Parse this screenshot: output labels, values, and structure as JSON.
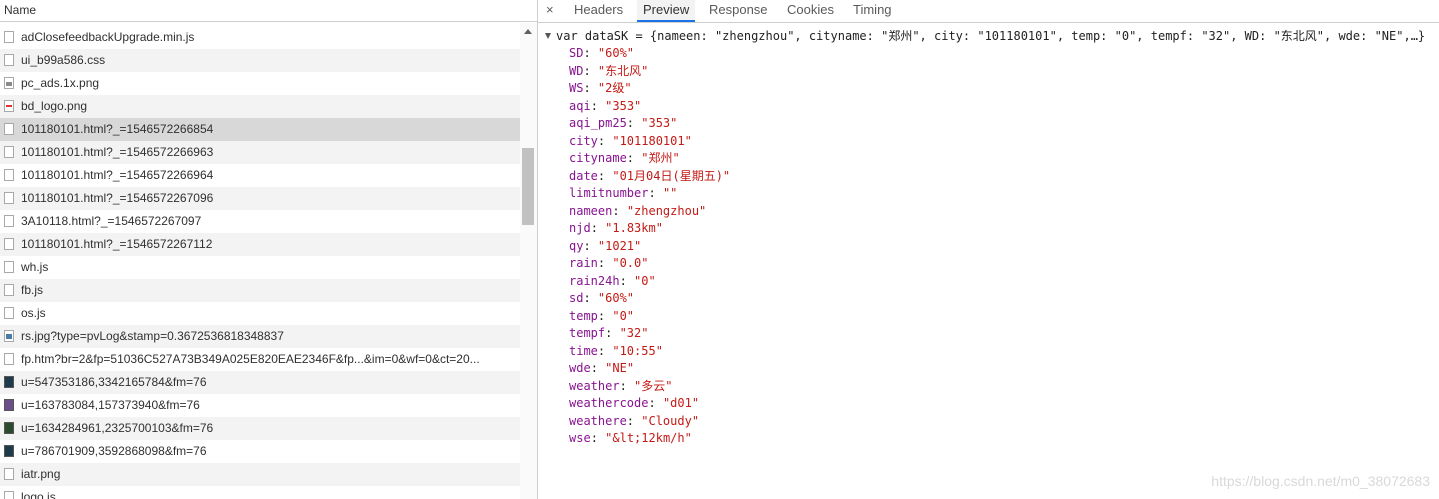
{
  "left_panel": {
    "column_header": "Name",
    "rows": [
      {
        "name": "adClosefeedbackUpgrade.min.js",
        "icon": "file-icon"
      },
      {
        "name": "ui_b99a586.css",
        "icon": "file-icon"
      },
      {
        "name": "pc_ads.1x.png",
        "icon": "image-file-icon"
      },
      {
        "name": "bd_logo.png",
        "icon": "image-file-icon"
      },
      {
        "name": "101180101.html?_=1546572266854",
        "icon": "file-icon",
        "selected": true
      },
      {
        "name": "101180101.html?_=1546572266963",
        "icon": "file-icon"
      },
      {
        "name": "101180101.html?_=1546572266964",
        "icon": "file-icon"
      },
      {
        "name": "101180101.html?_=1546572267096",
        "icon": "file-icon"
      },
      {
        "name": "3A10118.html?_=1546572267097",
        "icon": "file-icon"
      },
      {
        "name": "101180101.html?_=1546572267112",
        "icon": "file-icon"
      },
      {
        "name": "wh.js",
        "icon": "file-icon"
      },
      {
        "name": "fb.js",
        "icon": "file-icon"
      },
      {
        "name": "os.js",
        "icon": "file-icon"
      },
      {
        "name": "rs.jpg?type=pvLog&stamp=0.3672536818348837",
        "icon": "image-file-icon"
      },
      {
        "name": "fp.htm?br=2&fp=51036C527A73B349A025E820EAE2346F&fp...&im=0&wf=0&ct=20...",
        "icon": "file-icon"
      },
      {
        "name": "u=547353186,3342165784&fm=76",
        "icon": "image-thumbnail-icon"
      },
      {
        "name": "u=163783084,157373940&fm=76",
        "icon": "image-thumbnail-icon"
      },
      {
        "name": "u=1634284961,2325700103&fm=76",
        "icon": "image-thumbnail-icon"
      },
      {
        "name": "u=786701909,3592868098&fm=76",
        "icon": "image-thumbnail-icon"
      },
      {
        "name": "iatr.png",
        "icon": "file-icon"
      },
      {
        "name": "logo.js",
        "icon": "file-icon"
      }
    ]
  },
  "right_panel": {
    "close_symbol": "×",
    "tabs": [
      "Headers",
      "Preview",
      "Response",
      "Cookies",
      "Timing"
    ],
    "active_tab": "Preview",
    "preview": {
      "summary_line": "var dataSK = {nameen: \"zhengzhou\", cityname: \"郑州\", city: \"101180101\", temp: \"0\", tempf: \"32\", WD: \"东北风\", wde: \"NE\",…}",
      "properties": [
        {
          "key": "SD",
          "value": "\"60%\""
        },
        {
          "key": "WD",
          "value": "\"东北风\""
        },
        {
          "key": "WS",
          "value": "\"2级\""
        },
        {
          "key": "aqi",
          "value": "\"353\""
        },
        {
          "key": "aqi_pm25",
          "value": "\"353\""
        },
        {
          "key": "city",
          "value": "\"101180101\""
        },
        {
          "key": "cityname",
          "value": "\"郑州\""
        },
        {
          "key": "date",
          "value": "\"01月04日(星期五)\""
        },
        {
          "key": "limitnumber",
          "value": "\"\""
        },
        {
          "key": "nameen",
          "value": "\"zhengzhou\""
        },
        {
          "key": "njd",
          "value": "\"1.83km\""
        },
        {
          "key": "qy",
          "value": "\"1021\""
        },
        {
          "key": "rain",
          "value": "\"0.0\""
        },
        {
          "key": "rain24h",
          "value": "\"0\""
        },
        {
          "key": "sd",
          "value": "\"60%\""
        },
        {
          "key": "temp",
          "value": "\"0\""
        },
        {
          "key": "tempf",
          "value": "\"32\""
        },
        {
          "key": "time",
          "value": "\"10:55\""
        },
        {
          "key": "wde",
          "value": "\"NE\""
        },
        {
          "key": "weather",
          "value": "\"多云\""
        },
        {
          "key": "weathercode",
          "value": "\"d01\""
        },
        {
          "key": "weathere",
          "value": "\"Cloudy\""
        },
        {
          "key": "wse",
          "value": "\"&lt;12km/h\""
        }
      ]
    }
  },
  "watermark": "https://blog.csdn.net/m0_38072683"
}
